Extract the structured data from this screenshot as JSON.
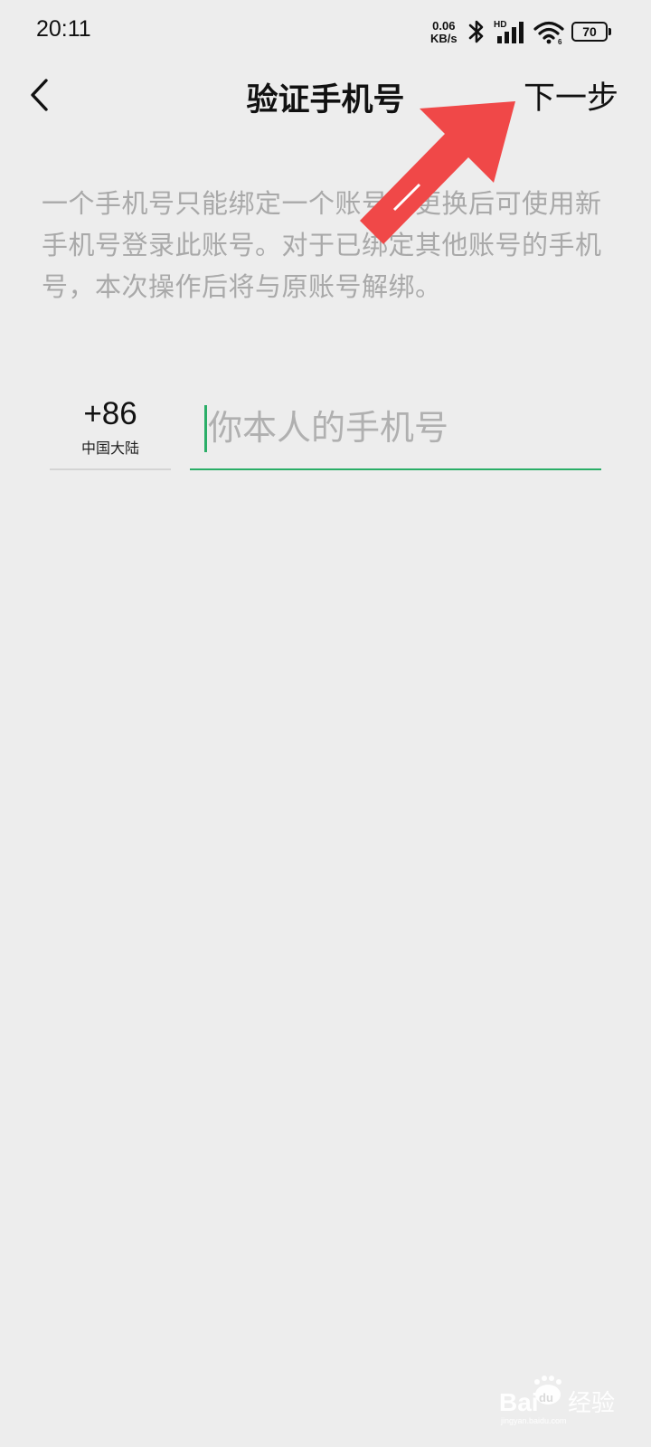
{
  "status_bar": {
    "time": "20:11",
    "net_speed_value": "0.06",
    "net_speed_unit": "KB/s",
    "network_label": "HD",
    "battery_level": "70",
    "icons": [
      "bluetooth-icon",
      "signal-icon",
      "wifi-icon",
      "battery-icon"
    ]
  },
  "nav": {
    "title": "验证手机号",
    "next_label": "下一步",
    "back_icon": "chevron-left-icon"
  },
  "description": "一个手机号只能绑定一个账号，更换后可使用新手机号登录此账号。对于已绑定其他账号的手机号，本次操作后将与原账号解绑。",
  "phone": {
    "country_code": "+86",
    "country_name": "中国大陆",
    "placeholder": "你本人的手机号",
    "value": ""
  },
  "colors": {
    "background": "#ededed",
    "accent_green": "#2aae67",
    "annotation_red": "#f04848",
    "hint_gray": "#a9a9a9"
  },
  "watermark": {
    "brand_latin": "Bai",
    "brand_latin_2": "du",
    "brand_cn": "经验",
    "domain": "jingyan.baidu.com"
  }
}
